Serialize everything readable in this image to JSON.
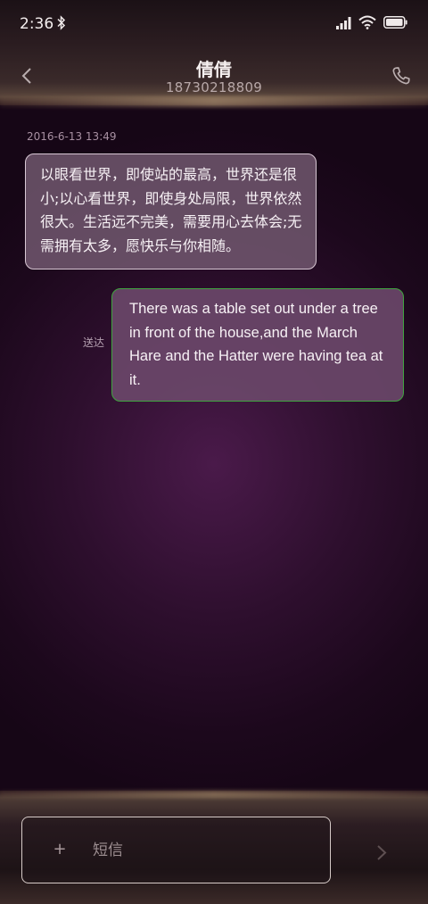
{
  "status_bar": {
    "time": "2:36",
    "icons": [
      "bluetooth-icon",
      "signal-icon",
      "wifi-icon",
      "battery-icon"
    ]
  },
  "header": {
    "contact_name": "倩倩",
    "contact_number": "18730218809",
    "icons": [
      "back-arrow-icon",
      "phone-icon"
    ]
  },
  "conversation": {
    "timestamp": "2016-6-13 13:49",
    "received_message": "以眼看世界，即使站的最高，世界还是很小;以心看世界，即使身处局限，世界依然很大。生活远不完美，需要用心去体会;无需拥有太多，愿快乐与你相随。",
    "sent_status": "送达",
    "sent_message": "There was a table set out under a tree in front of the house,and the March Hare and the Hatter were having tea at it."
  },
  "composer": {
    "attach_label": "+",
    "placeholder": "短信",
    "icons": [
      "send-arrow-icon"
    ]
  },
  "colors": {
    "background": "#2e0f2e",
    "sent_border": "#3fa43f",
    "received_border": "#d8c8d4"
  }
}
